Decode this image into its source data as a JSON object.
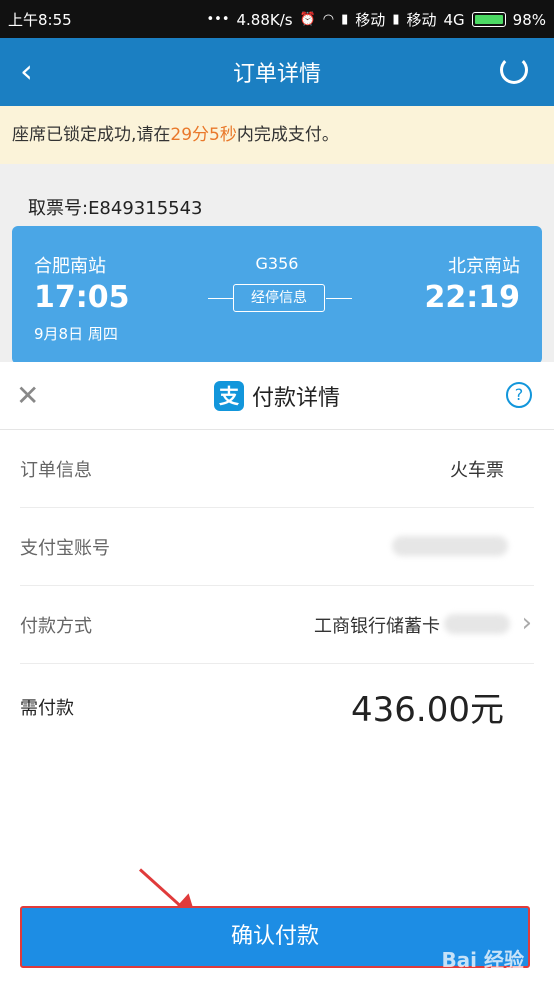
{
  "status_bar": {
    "time": "上午8:55",
    "speed": "4.88K/s",
    "carrier1": "移动",
    "carrier2": "移动",
    "network": "4G",
    "battery": "98%"
  },
  "header": {
    "title": "订单详情"
  },
  "notice": {
    "prefix": "座席已锁定成功,请在",
    "countdown": "29分5秒",
    "suffix": "内完成支付。"
  },
  "ticket": {
    "number": "取票号:E849315543",
    "from": "合肥南站",
    "to": "北京南站",
    "train_no": "G356",
    "depart_time": "17:05",
    "arrive_time": "22:19",
    "stops_label": "经停信息",
    "date": "9月8日 周四"
  },
  "sheet": {
    "title": "付款详情",
    "logo_char": "支",
    "rows": [
      {
        "label": "订单信息",
        "value": "火车票"
      },
      {
        "label": "支付宝账号",
        "value": ""
      },
      {
        "label": "付款方式",
        "value": "工商银行储蓄卡"
      }
    ],
    "amount_label": "需付款",
    "amount_value": "436.00元",
    "confirm_label": "确认付款"
  },
  "watermark": "Bai 经验",
  "colors": {
    "header": "#1b7fc2",
    "accent": "#1d8de4",
    "highlight": "#e9782a",
    "arrow": "#e03b3b"
  }
}
